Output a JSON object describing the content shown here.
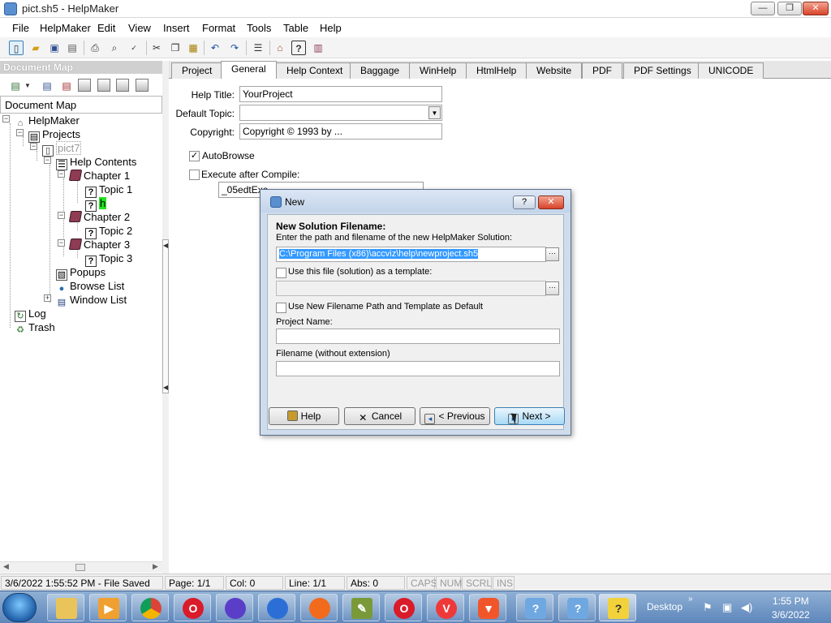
{
  "window": {
    "title": "pict.sh5 - HelpMaker"
  },
  "menu": [
    "File",
    "HelpMaker",
    "Edit",
    "View",
    "Insert",
    "Format",
    "Tools",
    "Table",
    "Help"
  ],
  "docmap": {
    "header": "Document Map",
    "title": "Document Map",
    "tree": {
      "root": "HelpMaker",
      "projects": "Projects",
      "project": "pict7",
      "help_contents": "Help Contents",
      "chapter1": "Chapter 1",
      "topic1": "Topic 1",
      "selected_topic": "h",
      "chapter2": "Chapter 2",
      "topic2": "Topic 2",
      "chapter3": "Chapter 3",
      "topic3": "Topic 3",
      "popups": "Popups",
      "browse_list": "Browse List",
      "window_list": "Window List",
      "log": "Log",
      "trash": "Trash"
    }
  },
  "tabs": [
    "Project",
    "General",
    "Help Context",
    "Baggage",
    "WinHelp",
    "HtmlHelp",
    "Website",
    "PDF",
    "PDF Settings",
    "UNICODE"
  ],
  "active_tab": "General",
  "form": {
    "help_title_label": "Help Title:",
    "help_title_value": "YourProject",
    "default_topic_label": "Default Topic:",
    "default_topic_value": "",
    "copyright_label": "Copyright:",
    "copyright_value": "Copyright © 1993 by ...",
    "autobrowse_label": "AutoBrowse",
    "autobrowse_checked": true,
    "execute_label": "Execute after Compile:",
    "execute_checked": false,
    "execute_value": "_05edtExe"
  },
  "dialog": {
    "title": "New",
    "help_btn": "?",
    "close_btn": "✕",
    "heading": "New Solution Filename:",
    "description": "Enter the path and filename of the new HelpMaker Solution:",
    "path_value": "C:\\Program Files (x86)\\accviz\\help\\newproject.sh5",
    "template_label": "Use this file (solution) as a template:",
    "template_value": "",
    "default_label": "Use New Filename Path and Template as Default",
    "project_name_label": "Project Name:",
    "project_name_value": "",
    "filename_label": "Filename (without extension)",
    "filename_value": "",
    "buttons": {
      "help": "Help",
      "cancel": "Cancel",
      "previous": "< Previous",
      "next": "Next >"
    }
  },
  "status": {
    "saved": "3/6/2022 1:55:52 PM - File Saved",
    "page": "Page: 1/1",
    "col": "Col: 0",
    "line": "Line: 1/1",
    "abs": "Abs: 0",
    "caps": "CAPS",
    "num": "NUM",
    "scrl": "SCRL",
    "ins": "INS"
  },
  "taskbar": {
    "desktop": "Desktop",
    "time": "1:55 PM",
    "date": "3/6/2022",
    "apps": [
      "file-explorer",
      "media-player",
      "chrome",
      "opera",
      "firefox",
      "firefox-dev",
      "firefox-nightly",
      "ide",
      "opera-gx",
      "vivaldi",
      "brave",
      "help-1",
      "help-2",
      "helpmaker"
    ]
  }
}
